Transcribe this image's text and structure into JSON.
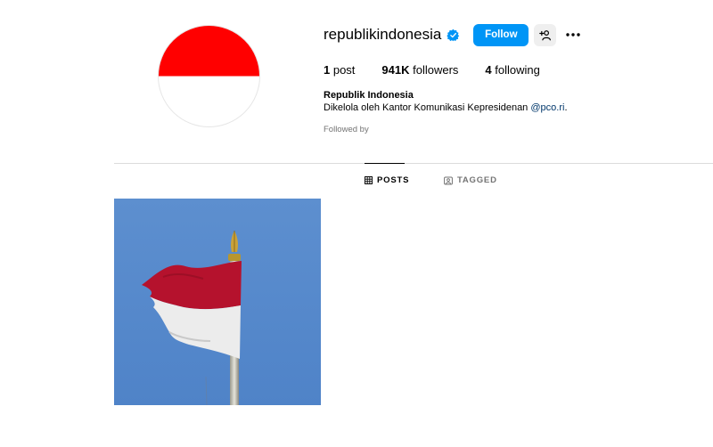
{
  "profile": {
    "username": "republikindonesia",
    "follow_label": "Follow",
    "full_name": "Republik Indonesia",
    "bio_text": "Dikelola oleh Kantor Komunikasi Kepresidenan ",
    "bio_link": "@pco.ri",
    "bio_suffix": ".",
    "followed_by": "Followed by"
  },
  "stats": {
    "posts_count": "1",
    "posts_label": " post",
    "followers_count": "941K",
    "followers_label": " followers",
    "following_count": "4",
    "following_label": " following"
  },
  "tabs": [
    {
      "label": "POSTS",
      "icon": "grid-icon",
      "active": true
    },
    {
      "label": "TAGGED",
      "icon": "tagged-icon",
      "active": false
    }
  ],
  "colors": {
    "accent": "#0095f6",
    "flag_red": "#ff0000",
    "verified": "#0095f6"
  }
}
